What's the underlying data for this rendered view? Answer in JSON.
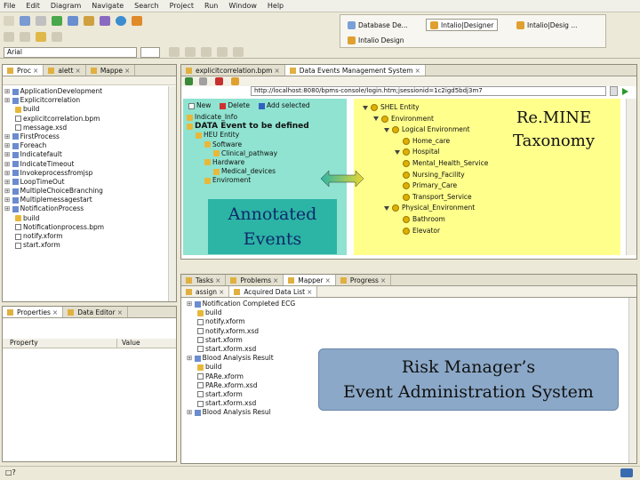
{
  "menu": [
    "File",
    "Edit",
    "Diagram",
    "Navigate",
    "Search",
    "Project",
    "Run",
    "Window",
    "Help"
  ],
  "toolbar": {
    "search_value": "Arial",
    "perspectives": [
      "Database De...",
      "Intalio|Designer",
      "Intalio|Desig ...",
      "Intalio Design"
    ]
  },
  "left_top": {
    "tabs": [
      "Proc",
      "alett",
      "Mappe"
    ],
    "items": [
      {
        "label": "ApplicationDevelopment",
        "indent": 1,
        "icon": "proj"
      },
      {
        "label": "Explicitcorrelation",
        "indent": 1,
        "icon": "proj"
      },
      {
        "label": "build",
        "indent": 2,
        "icon": "folder"
      },
      {
        "label": "explicitcorrelation.bpm",
        "indent": 2,
        "icon": "file"
      },
      {
        "label": "message.xsd",
        "indent": 2,
        "icon": "file"
      },
      {
        "label": "FirstProcess",
        "indent": 1,
        "icon": "proj"
      },
      {
        "label": "Foreach",
        "indent": 1,
        "icon": "proj"
      },
      {
        "label": "Indicatefault",
        "indent": 1,
        "icon": "proj"
      },
      {
        "label": "IndicateTimeout",
        "indent": 1,
        "icon": "proj"
      },
      {
        "label": "Invokeprocessfromjsp",
        "indent": 1,
        "icon": "proj"
      },
      {
        "label": "LoopTimeOut",
        "indent": 1,
        "icon": "proj"
      },
      {
        "label": "MultipleChoiceBranching",
        "indent": 1,
        "icon": "proj"
      },
      {
        "label": "Multiplemessagestart",
        "indent": 1,
        "icon": "proj"
      },
      {
        "label": "NotificationProcess",
        "indent": 1,
        "icon": "proj"
      },
      {
        "label": "build",
        "indent": 2,
        "icon": "folder"
      },
      {
        "label": "Notificationprocess.bpm",
        "indent": 2,
        "icon": "file"
      },
      {
        "label": "notify.xform",
        "indent": 2,
        "icon": "file"
      },
      {
        "label": "start.xform",
        "indent": 2,
        "icon": "file"
      }
    ]
  },
  "left_bottom": {
    "tabs": [
      "Properties",
      "Data Editor"
    ],
    "columns": [
      "Property",
      "Value"
    ]
  },
  "editor": {
    "tabs": [
      "explicitcorrelation.bpm",
      "Data Events Management System"
    ],
    "url": "http://localhost:8080/bpms-console/login.htm;jsessionid=1c2igd5bdj3m7",
    "actions": [
      "New",
      "Delete",
      "Add selected"
    ],
    "left_tree": [
      "Indicate_Info",
      "DATA Event to be defined",
      "HEU Entity",
      "Software",
      "Clinical_pathway",
      "Hardware",
      "Medical_devices",
      "Enviroment"
    ],
    "right_tree": [
      "SHEL Entity",
      "Environment",
      "Logical Environment",
      "Home_care",
      "Hospital",
      "Mental_Health_Service",
      "Nursing_Facility",
      "Primary_Care",
      "Transport_Service",
      "Physical_Environment",
      "Bathroom",
      "Elevator"
    ]
  },
  "annotations": {
    "taxonomy": [
      "Re.MINE",
      "Taxonomy"
    ],
    "events": [
      "Annotated",
      "Events"
    ],
    "risk": [
      "Risk Manager’s",
      "Event Administration System"
    ]
  },
  "bottom": {
    "tabs": [
      "Tasks",
      "Problems",
      "Mapper",
      "Progress"
    ],
    "subtabs": [
      "assign",
      "Acquired Data List"
    ],
    "items": [
      {
        "label": "Notification Completed ECG",
        "indent": 1,
        "icon": "proj"
      },
      {
        "label": "build",
        "indent": 2,
        "icon": "folder"
      },
      {
        "label": "notify.xform",
        "indent": 2,
        "icon": "file"
      },
      {
        "label": "notify.xform.xsd",
        "indent": 2,
        "icon": "file"
      },
      {
        "label": "start.xform",
        "indent": 2,
        "icon": "file"
      },
      {
        "label": "start.xform.xsd",
        "indent": 2,
        "icon": "file"
      },
      {
        "label": "Blood Analysis Result",
        "indent": 1,
        "icon": "proj"
      },
      {
        "label": "build",
        "indent": 2,
        "icon": "folder"
      },
      {
        "label": "PARe.xform",
        "indent": 2,
        "icon": "file"
      },
      {
        "label": "PARe.xform.xsd",
        "indent": 2,
        "icon": "file"
      },
      {
        "label": "start.xform",
        "indent": 2,
        "icon": "file"
      },
      {
        "label": "start.xform.xsd",
        "indent": 2,
        "icon": "file"
      },
      {
        "label": "Blood Analysis Resul",
        "indent": 1,
        "icon": "proj"
      }
    ]
  },
  "status": {
    "text": "□?"
  },
  "colors": {
    "taxonomy_bg": "#ffff8c",
    "events_bg": "#8fe3d0",
    "events_box": "#2cb4a5",
    "risk_box": "#8ba8c8"
  }
}
